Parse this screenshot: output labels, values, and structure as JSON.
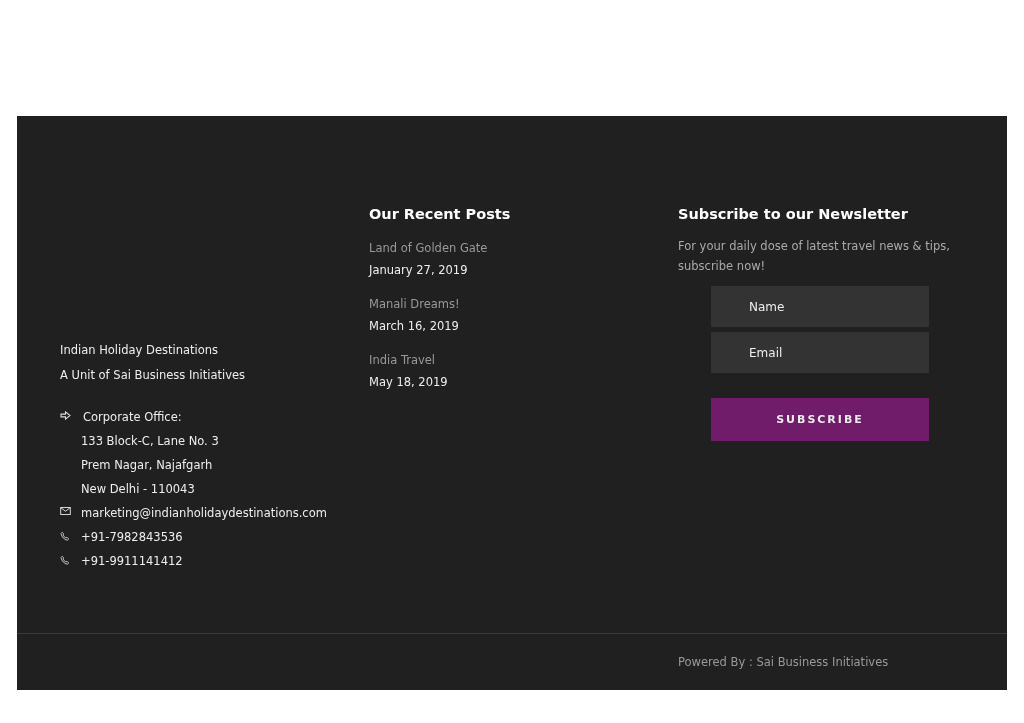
{
  "about": {
    "lines": [
      "Indian Holiday Destinations",
      "A Unit of Sai Business Initiatives"
    ]
  },
  "contacts": [
    {
      "kind": "address",
      "lines": [
        "Corporate Office:",
        "133 Block-C, Lane No. 3",
        "Prem Nagar, Najafgarh",
        "New Delhi - 110043"
      ]
    },
    {
      "kind": "email",
      "lines": [
        "marketing@indianholidaydestinations.com"
      ]
    },
    {
      "kind": "phone",
      "lines": [
        "+91-7982843536"
      ]
    },
    {
      "kind": "phone",
      "lines": [
        "+91-9911141412"
      ]
    }
  ],
  "recent_posts": {
    "title": "Our Recent Posts",
    "posts": [
      {
        "title": "Land of Golden Gate",
        "date": "January 27, 2019"
      },
      {
        "title": "Manali Dreams!",
        "date": "March 16, 2019"
      },
      {
        "title": "India Travel",
        "date": "May 18, 2019"
      }
    ]
  },
  "newsletter": {
    "title": "Subscribe to our Newsletter",
    "text": "For your daily dose of latest travel news & tips, subscribe now!",
    "fields": [
      {
        "placeholder": "Name"
      },
      {
        "placeholder": "Email"
      }
    ],
    "button": "SUBSCRIBE"
  },
  "footer_bottom": {
    "text": "Powered By : Sai Business Initiatives"
  }
}
